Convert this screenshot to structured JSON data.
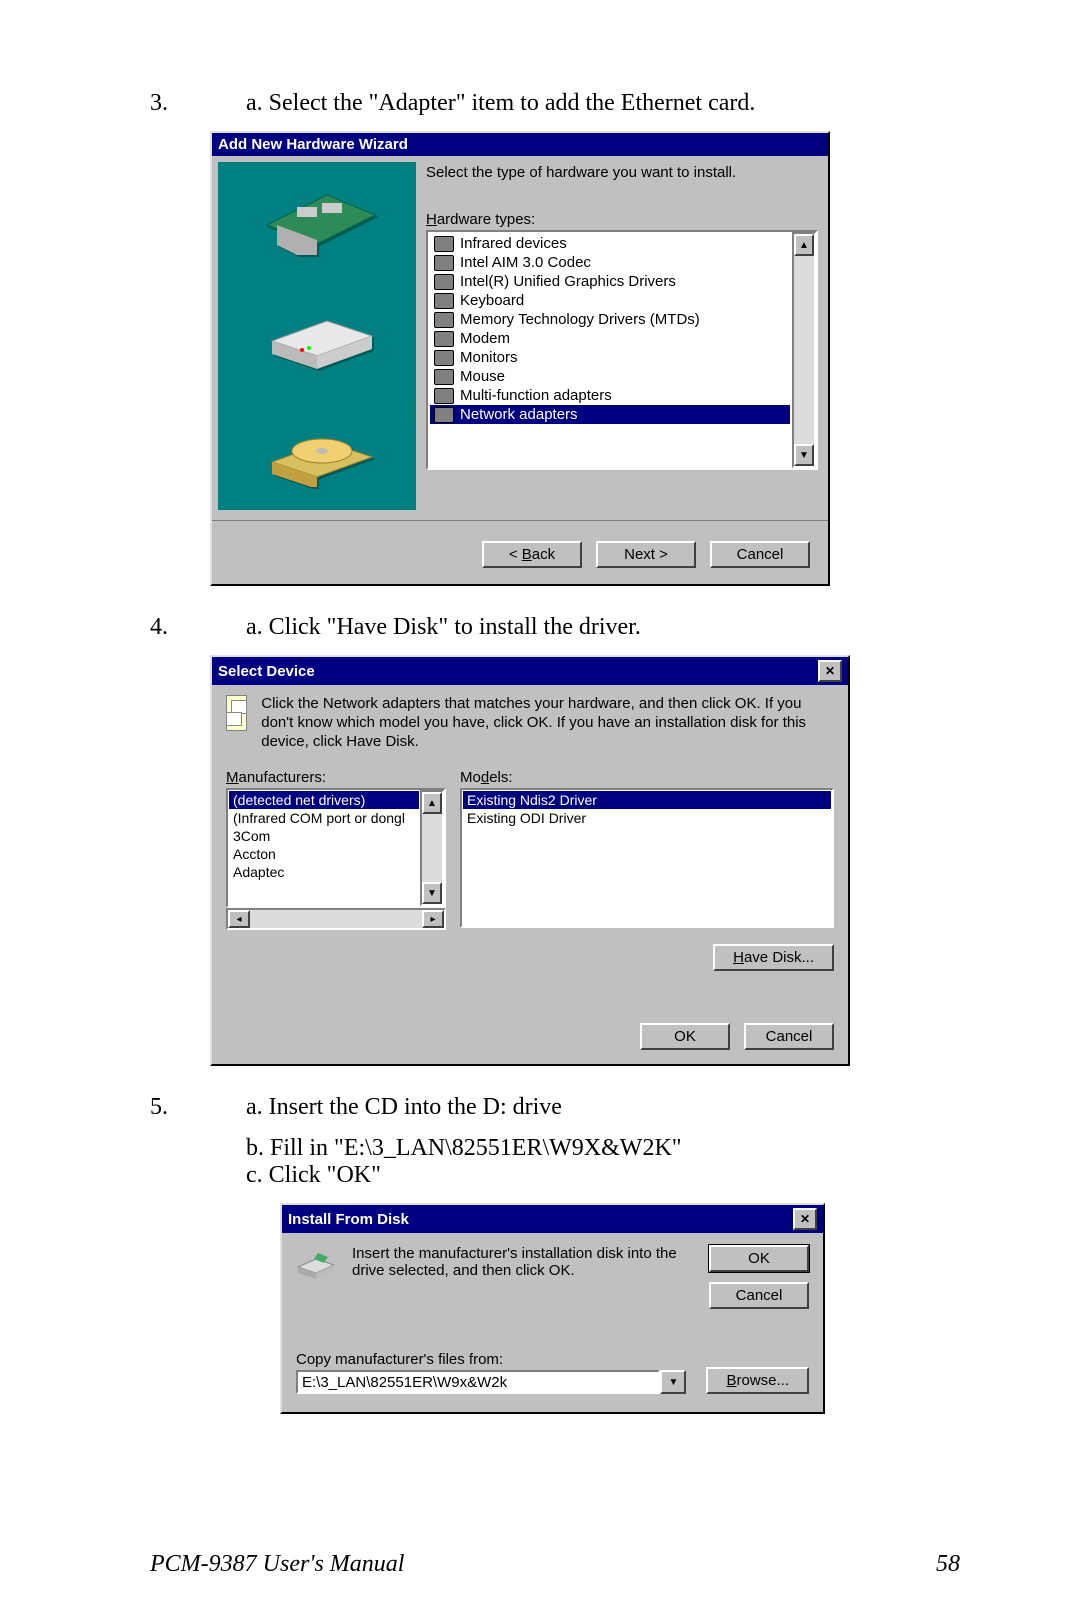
{
  "steps": {
    "s3": {
      "num": "3.",
      "a": "a. Select the \"Adapter\" item to add the Ethernet card."
    },
    "s4": {
      "num": "4.",
      "a": "a. Click \"Have Disk\" to install the driver."
    },
    "s5": {
      "num": "5.",
      "a": "a. Insert the CD into the D: drive",
      "b": "b. Fill in \"E:\\3_LAN\\82551ER\\W9X&W2K\"",
      "c": "c. Click \"OK\""
    }
  },
  "dlg1": {
    "title": "Add New Hardware Wizard",
    "prompt": "Select the type of hardware you want to install.",
    "listLabel": "Hardware types:",
    "listLabelU": "H",
    "items": [
      "Infrared devices",
      "Intel AIM 3.0 Codec",
      "Intel(R) Unified Graphics Drivers",
      "Keyboard",
      "Memory Technology Drivers (MTDs)",
      "Modem",
      "Monitors",
      "Mouse",
      "Multi-function adapters",
      "Network adapters"
    ],
    "selectedIndex": 9,
    "back": "< Back",
    "next": "Next >",
    "cancel": "Cancel"
  },
  "dlg2": {
    "title": "Select Device",
    "desc": "Click the Network adapters that matches your hardware, and then click OK. If you don't know which model you have, click OK. If you have an installation disk for this device, click Have Disk.",
    "manufLabel": "Manufacturers:",
    "modelsLabel": "Models:",
    "manufacturers": [
      "(detected net drivers)",
      "(Infrared COM port or dongl",
      "3Com",
      "Accton",
      "Adaptec"
    ],
    "manufSelectedIndex": 0,
    "models": [
      "Existing Ndis2 Driver",
      "Existing ODI Driver"
    ],
    "modelsSelectedIndex": 0,
    "haveDisk": "Have Disk...",
    "ok": "OK",
    "cancel": "Cancel"
  },
  "dlg3": {
    "title": "Install From Disk",
    "msg": "Insert the manufacturer's installation disk into the drive selected, and then click OK.",
    "copyLabel": "Copy manufacturer's files from:",
    "path": "E:\\3_LAN\\82551ER\\W9x&W2k",
    "ok": "OK",
    "cancel": "Cancel",
    "browse": "Browse..."
  },
  "footer": {
    "manual": "PCM-9387 User's Manual",
    "page": "58"
  }
}
